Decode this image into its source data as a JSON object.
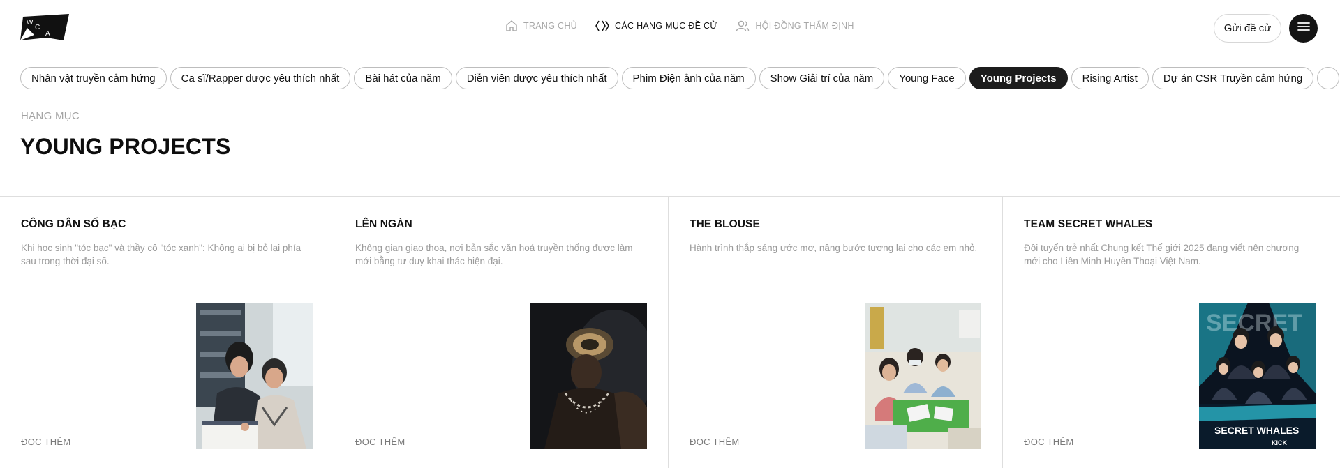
{
  "header": {
    "logo_letters": [
      "W",
      "C",
      "A"
    ],
    "nav": [
      {
        "label": "TRANG CHỦ",
        "icon": "home-icon",
        "active": false
      },
      {
        "label": "CÁC HẠNG MỤC ĐỀ CỬ",
        "icon": "chevrons-icon",
        "active": true
      },
      {
        "label": "HỘI ĐỒNG THẨM ĐỊNH",
        "icon": "users-icon",
        "active": false
      }
    ],
    "submit_label": "Gửi đề cử",
    "menu_icon": "hamburger-icon"
  },
  "tabs": [
    {
      "label": "Nhân vật truyền cảm hứng",
      "active": false
    },
    {
      "label": "Ca sĩ/Rapper được yêu thích nhất",
      "active": false
    },
    {
      "label": "Bài hát của năm",
      "active": false
    },
    {
      "label": "Diễn viên được yêu thích nhất",
      "active": false
    },
    {
      "label": "Phim Điện ảnh của năm",
      "active": false
    },
    {
      "label": "Show Giải trí của năm",
      "active": false
    },
    {
      "label": "Young Face",
      "active": false
    },
    {
      "label": "Young Projects",
      "active": true
    },
    {
      "label": "Rising Artist",
      "active": false
    },
    {
      "label": "Dự án CSR Truyền cảm hứng",
      "active": false
    },
    {
      "label": "",
      "active": false
    }
  ],
  "section": {
    "eyebrow": "HẠNG MỤC",
    "title": "YOUNG PROJECTS"
  },
  "cards": [
    {
      "title": "CÔNG DÂN SỐ BẠC",
      "description": "Khi học sinh \"tóc bạc\" và thầy cô \"tóc xanh\": Không ai bị bỏ lại phía sau trong thời đại số.",
      "link": "ĐỌC THÊM",
      "image": "photo-teacher-and-elderly-student"
    },
    {
      "title": "LÊN NGÀN",
      "description": "Không gian giao thoa, nơi bản sắc văn hoá truyền thống được làm mới bằng tư duy khai thác hiện đại.",
      "link": "ĐỌC THÊM",
      "image": "photo-traditional-costume-portrait"
    },
    {
      "title": "THE BLOUSE",
      "description": "Hành trình thắp sáng ước mơ, nâng bước tương lai cho các em nhỏ.",
      "link": "ĐỌC THÊM",
      "image": "photo-children-classroom"
    },
    {
      "title": "TEAM SECRET WHALES",
      "description": "Đội tuyển trẻ nhất Chung kết Thế giới 2025 đang viết nên chương mới cho Liên Minh Huyền Thoại Việt Nam.",
      "link": "ĐỌC THÊM",
      "image": "poster-esports-team",
      "poster_text": [
        "SECRET",
        "SECRET WHALES",
        "KICK"
      ]
    }
  ],
  "colors": {
    "accent_dark": "#1c1c1c",
    "muted_text": "#9a9a9a",
    "border": "#dedede"
  }
}
